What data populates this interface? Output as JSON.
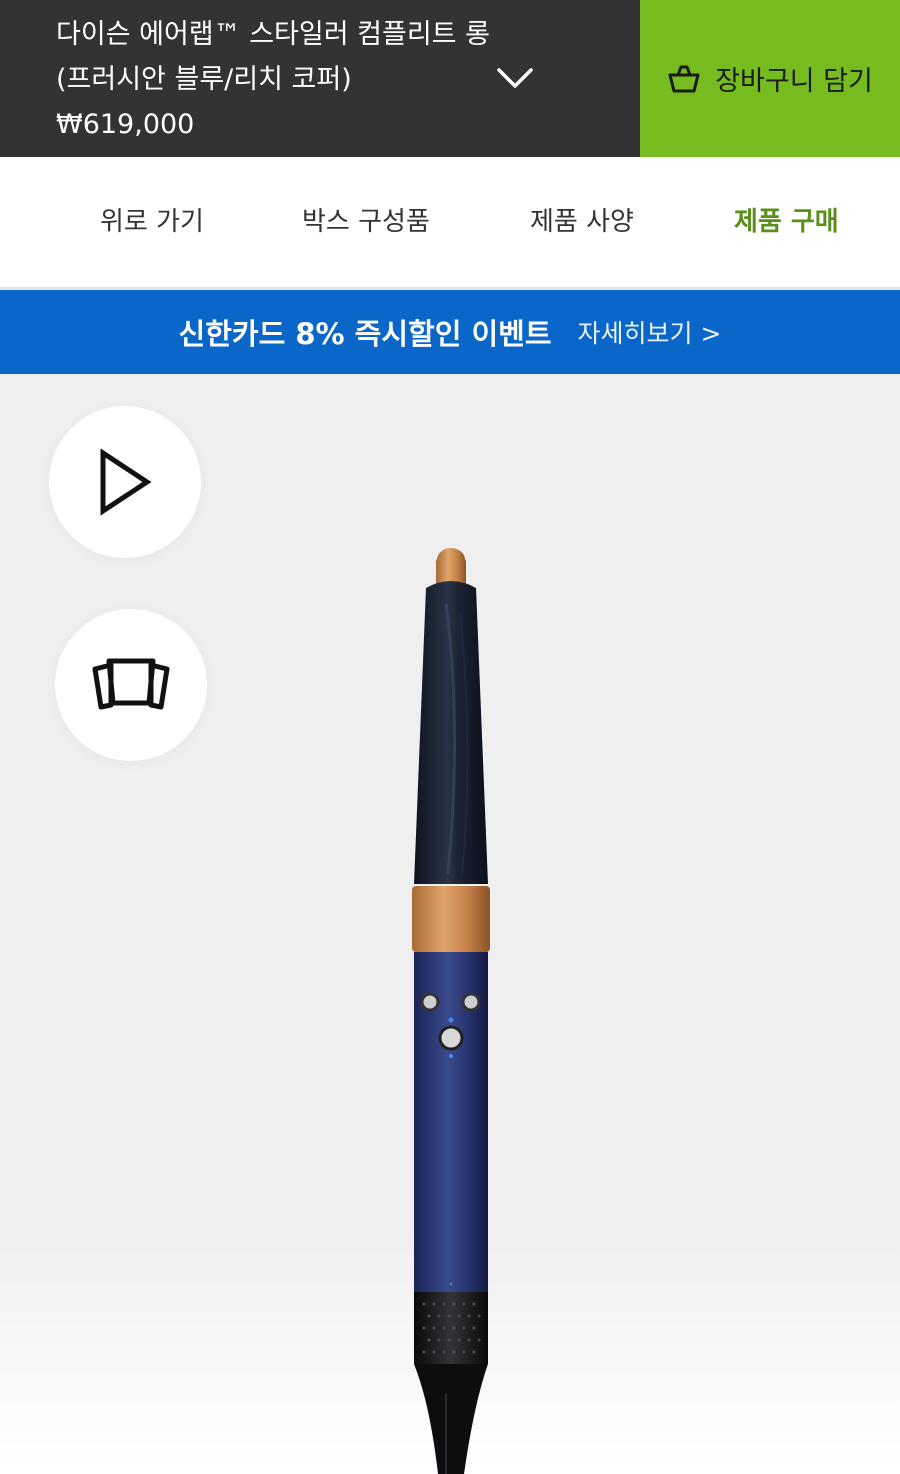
{
  "header": {
    "product_name": "다이슨 에어랩™ 스타일러 컴플리트 롱 (프러시안 블루/리치 코퍼)",
    "price": "₩619,000",
    "expand_icon": "chevron-down-icon",
    "cart_button_label": "장바구니 담기",
    "cart_icon": "basket-icon",
    "colors": {
      "dark": "#333333",
      "cart_green": "#77bc1f"
    }
  },
  "nav": {
    "items": [
      {
        "label": "위로 가기",
        "active": false
      },
      {
        "label": "박스 구성품",
        "active": false
      },
      {
        "label": "제품 사양",
        "active": false
      },
      {
        "label": "제품 구매",
        "active": true
      }
    ],
    "active_color": "#5a8f1c"
  },
  "promo": {
    "title": "신한카드 8% 즉시할인 이벤트",
    "link": "자세히보기 >",
    "color": "#0a66c9"
  },
  "hero": {
    "play_icon": "play-icon",
    "gallery_icon": "gallery-icon",
    "product_image": "airwrap-styler-image"
  }
}
